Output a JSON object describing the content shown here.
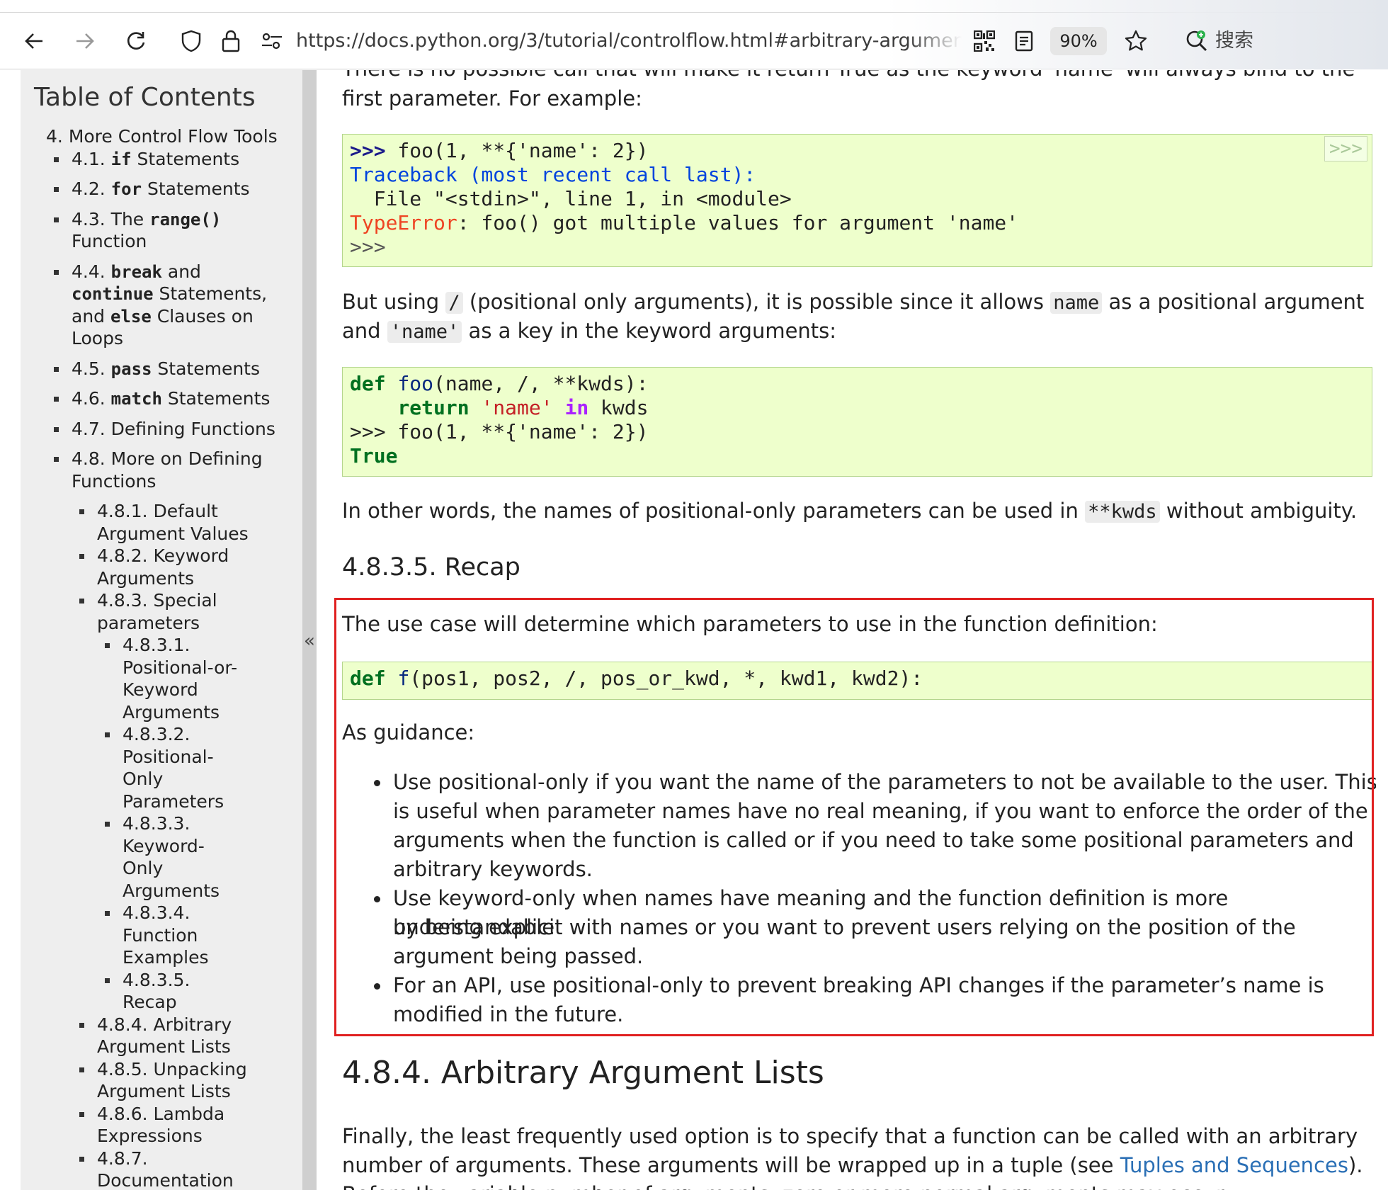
{
  "browser": {
    "url": "https://docs.python.org/3/tutorial/controlflow.html#arbitrary-argument-lists",
    "zoom": "90%",
    "search_label": "搜索"
  },
  "sidebar": {
    "title": "Table of Contents",
    "items": [
      {
        "lines": [
          "4. More Control Flow Tools"
        ],
        "level": 0
      },
      {
        "lines": [
          "4.1. if Statements"
        ],
        "level": 1
      },
      {
        "lines": [
          "4.2. for Statements"
        ],
        "level": 1
      },
      {
        "lines": [
          "4.3. The range()",
          "Function"
        ],
        "level": 1
      },
      {
        "lines": [
          "4.4. break and",
          "continue Statements,",
          "and else Clauses on",
          "Loops"
        ],
        "level": 1
      },
      {
        "lines": [
          "4.5. pass Statements"
        ],
        "level": 1
      },
      {
        "lines": [
          "4.6. match Statements"
        ],
        "level": 1
      },
      {
        "lines": [
          "4.7. Defining Functions"
        ],
        "level": 1
      },
      {
        "lines": [
          "4.8. More on Defining",
          "Functions"
        ],
        "level": 1
      },
      {
        "lines": [
          "4.8.1. Default",
          "Argument Values"
        ],
        "level": 2
      },
      {
        "lines": [
          "4.8.2. Keyword",
          "Arguments"
        ],
        "level": 2
      },
      {
        "lines": [
          "4.8.3. Special",
          "parameters"
        ],
        "level": 2
      },
      {
        "lines": [
          "4.8.3.1.",
          "Positional-or-",
          "Keyword",
          "Arguments"
        ],
        "level": 3
      },
      {
        "lines": [
          "4.8.3.2.",
          "Positional-",
          "Only",
          "Parameters"
        ],
        "level": 3
      },
      {
        "lines": [
          "4.8.3.3.",
          "Keyword-",
          "Only",
          "Arguments"
        ],
        "level": 3
      },
      {
        "lines": [
          "4.8.3.4.",
          "Function",
          "Examples"
        ],
        "level": 3
      },
      {
        "lines": [
          "4.8.3.5.",
          "Recap"
        ],
        "level": 3
      },
      {
        "lines": [
          "4.8.4. Arbitrary",
          "Argument Lists"
        ],
        "level": 2
      },
      {
        "lines": [
          "4.8.5. Unpacking",
          "Argument Lists"
        ],
        "level": 2
      },
      {
        "lines": [
          "4.8.6. Lambda",
          "Expressions"
        ],
        "level": 2
      },
      {
        "lines": [
          "4.8.7.",
          "Documentation"
        ],
        "level": 2
      }
    ],
    "collapse_label": "«"
  },
  "content": {
    "cut_line": "There is no possible call that will make it return True as the keyword 'name' will always bind to the",
    "para1_end": "first parameter. For example:",
    "code1": {
      "prompt_button": ">>>",
      "line1_prompt": ">>>",
      "line1_rest": " foo(1, **{'name': 2})",
      "line2": "Traceback (most recent call last):",
      "line3": "  File \"<stdin>\", line 1, in <module>",
      "line4_err": "TypeError",
      "line4_rest": ": foo() got multiple values for argument 'name'",
      "line5": ">>>"
    },
    "para2_a": "But using ",
    "para2_code1": "/",
    "para2_b": " (positional only arguments), it is possible since it allows ",
    "para2_code2": "name",
    "para2_c": " as a positional argument",
    "para2_line2_a": "and ",
    "para2_code3": "'name'",
    "para2_line2_b": " as a key in the keyword arguments:",
    "code2": {
      "l1_def": "def",
      "l1_fn": "foo",
      "l1_rest": "(name, /, **kwds):",
      "l2_ret": "return",
      "l2_str": "'name'",
      "l2_in": "in",
      "l2_rest": " kwds",
      "l3": ">>> foo(1, **{'name': 2})",
      "l4": "True"
    },
    "para3_a": "In other words, the names of positional-only parameters can be used in ",
    "para3_code": "**kwds",
    "para3_b": " without ambiguity.",
    "recap_heading": "4.8.3.5. Recap",
    "recap_intro": "The use case will determine which parameters to use in the function definition:",
    "code3": {
      "def": "def",
      "fn": "f",
      "rest": "(pos1, pos2, /, pos_or_kwd, *, kwd1, kwd2):"
    },
    "guidance": "As guidance:",
    "bullets": [
      [
        "Use positional-only if you want the name of the parameters to not be available to the user. This",
        "is useful when parameter names have no real meaning, if you want to enforce the order of the",
        "arguments when the function is called or if you need to take some positional parameters and",
        "arbitrary keywords."
      ],
      [
        "Use keyword-only when names have meaning and the function definition is more understandable",
        "by being explicit with names or you want to prevent users relying on the position of the",
        "argument being passed."
      ],
      [
        "For an API, use positional-only to prevent breaking API changes if the parameter’s name is",
        "modified in the future."
      ]
    ],
    "h2": "4.8.4. Arbitrary Argument Lists",
    "final_line1": "Finally, the least frequently used option is to specify that a function can be called with an arbitrary",
    "final_line2_a": "number of arguments. These arguments will be wrapped up in a tuple (see ",
    "final_link": "Tuples and Sequences",
    "final_line2_b": ").",
    "final_line3_cut": "Before the variable number of arguments, zero or more normal arguments may occur."
  },
  "colors": {
    "code_bg": "#eeffcc",
    "sidebar_bg": "#eeeeee",
    "highlight": "#e02020",
    "link": "#2a6fb5"
  }
}
